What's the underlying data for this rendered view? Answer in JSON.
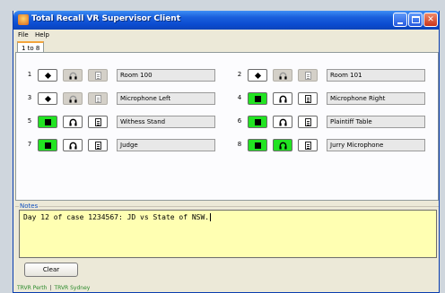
{
  "window": {
    "title": "Total Recall VR Supervisor Client"
  },
  "menu": {
    "file": "File",
    "help": "Help"
  },
  "tabs": [
    {
      "label": "1 to 8"
    }
  ],
  "channels": [
    {
      "number": "1",
      "name": "Room 100",
      "state": "stopped",
      "phones_enabled": false,
      "doc_enabled": false
    },
    {
      "number": "2",
      "name": "Room 101",
      "state": "stopped",
      "phones_enabled": false,
      "doc_enabled": false
    },
    {
      "number": "3",
      "name": "Microphone Left",
      "state": "stopped",
      "phones_enabled": false,
      "doc_enabled": false
    },
    {
      "number": "4",
      "name": "Microphone Right",
      "state": "recording",
      "phones_enabled": true,
      "doc_enabled": true
    },
    {
      "number": "5",
      "name": "Withess Stand",
      "state": "recording",
      "phones_enabled": true,
      "doc_enabled": true
    },
    {
      "number": "6",
      "name": "Plaintiff Table",
      "state": "recording",
      "phones_enabled": true,
      "doc_enabled": true
    },
    {
      "number": "7",
      "name": "Judge",
      "state": "recording",
      "phones_enabled": true,
      "doc_enabled": true
    },
    {
      "number": "8",
      "name": "Jurry Microphone",
      "state": "recording",
      "phones_enabled": true,
      "doc_enabled": true,
      "monitoring": true
    }
  ],
  "notes": {
    "label": "Notes",
    "text": "Day 12 of case 1234567: JD vs State of NSW.",
    "clear_label": "Clear"
  },
  "status": {
    "server1": "TRVR Perth",
    "separator": "|",
    "server2": "TRVR Sydney"
  },
  "colors": {
    "recording": "#22e322",
    "notes_bg": "#ffffb2",
    "titlebar": "#0a4bd0"
  }
}
